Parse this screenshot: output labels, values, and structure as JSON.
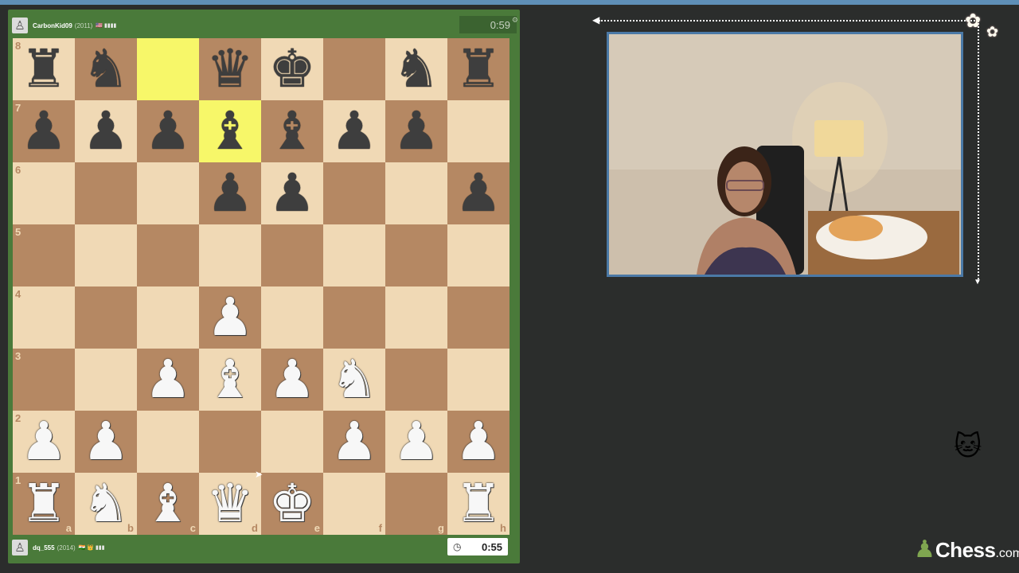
{
  "top_player": {
    "name": "CarbonKid09",
    "rating": "(2011)",
    "flags": "🇺🇸 ▮▮▮▮",
    "clock": "0:59"
  },
  "bottom_player": {
    "name": "dq_555",
    "rating": "(2014)",
    "flags": "🇮🇳 👑 ▮▮▮",
    "clock": "0:55"
  },
  "board": {
    "ranks": [
      [
        "bR",
        "bN",
        "",
        "bQ",
        "bK",
        "",
        "bN",
        "bR"
      ],
      [
        "bP",
        "bP",
        "bP",
        "bB",
        "bB",
        "bP",
        "bP",
        ""
      ],
      [
        "",
        "",
        "",
        "bP",
        "bP",
        "",
        "",
        "bP"
      ],
      [
        "",
        "",
        "",
        "",
        "",
        "",
        "",
        ""
      ],
      [
        "",
        "",
        "",
        "wP",
        "",
        "",
        "",
        ""
      ],
      [
        "",
        "",
        "wP",
        "wB",
        "wP",
        "wN",
        "",
        ""
      ],
      [
        "wP",
        "wP",
        "",
        "",
        "",
        "wP",
        "wP",
        "wP"
      ],
      [
        "wR",
        "wN",
        "wB",
        "wQ",
        "wK",
        "",
        "",
        "wR"
      ]
    ],
    "highlighted": [
      "c8",
      "d7"
    ],
    "rank_labels": [
      "8",
      "7",
      "6",
      "5",
      "4",
      "3",
      "2",
      "1"
    ],
    "file_labels": [
      "a",
      "b",
      "c",
      "d",
      "e",
      "f",
      "g",
      "h"
    ]
  },
  "logo": {
    "text": "Chess",
    "tld": ".com"
  },
  "icons": {
    "clock": "clock-icon",
    "avatar": "pawn-avatar-icon",
    "logo": "chess-pawn-logo-icon",
    "sticker": "cat-sticker-icon"
  }
}
